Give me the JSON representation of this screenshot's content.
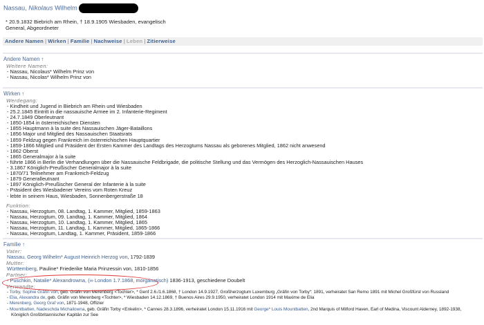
{
  "header": {
    "surname": "Nassau,",
    "given": "Nikolaus",
    "second": "Wilhelm",
    "life_line": "* 20.9.1832 Biebrich am Rhein, † 18.9.1905 Wiesbaden, evangelisch",
    "occupation": "General, Abgeordneter"
  },
  "nav": [
    "Andere Namen",
    "Wirken",
    "Familie",
    "Nachweise",
    "Leben",
    "Zitierweise"
  ],
  "andere_namen": {
    "title": "Andere Namen ↑",
    "sub": "Weitere Namen:",
    "items": [
      "Nassau, Nicolaus* Wilhelm Prinz von",
      "Nassau, Nicolas* Wilhelm Prinz von"
    ]
  },
  "wirken": {
    "title": "Wirken ↑",
    "sub": "Werdegang:",
    "items": [
      "Kindheit und Jugend in Biebrich am Rhein und Wiesbaden",
      "25.2.1845 Eintritt in die nassauische Armee im 2. Infanterie-Regiment",
      "24.7.1849 Oberleutnant",
      "1850-1854 in österreichischen Diensten",
      "1855 Hauptmann à la suite des Nassauischen Jäger-Bataillons",
      "1856 Major und Mitglied des Nassauischen Staatsrats",
      "1859 Feldzug gegen Frankreich im österreichischen Hauptquartier",
      "1859-1866 Mitglied und Präsident der Ersten Kammer des Landtags des Herzogtums Nassau als geborenes Mitglied, 1862 nicht anwesend",
      "1862 Oberst",
      "1865 Generalmajor à la suite",
      "führte 1866 in Berlin die Verhandlungen über die Nassauische Feldbrigade, die politische Stellung und das Vermögen des Herzoglich-Nassauischen Hauses",
      "3.1867 Königlich-Preußischer Generalmajor à la suite",
      "1870/71 Teilnehmer am Frankreich-Feldzug",
      "1879 Generalleutnant",
      "1897 Königlich-Preußischer General der Infanterie à la suite",
      "Präsident des Wiesbadener Vereins vom Roten Kreuz",
      "lebte in seinem Haus, Wiesbaden, Sonnenbergerstraße 18"
    ],
    "funktion_sub": "Funktion:",
    "funktion": [
      "Nassau, Herzogtum, 08. Landtag, 1. Kammer, Mitglied, 1859-1863",
      "Nassau, Herzogtum, 09. Landtag, 1. Kammer, Mitglied, 1864",
      "Nassau, Herzogtum, 10. Landtag, 1. Kammer, Mitglied, 1865",
      "Nassau, Herzogtum, 11. Landtag, 1. Kammer, Mitglied, 1865-1866",
      "Nassau, Herzogtum, Landtag, 1. Kammer, Präsident, 1859-1866"
    ]
  },
  "familie": {
    "title": "Familie ↑",
    "vater_sub": "Vater:",
    "vater_link": "Nassau, Georg Wilhelm* August Heinrich Herzog von",
    "vater_rest": ", 1792-1839",
    "mutter_sub": "Mutter:",
    "mutter_link": "Württemberg",
    "mutter_rest": ", Pauline* Friederike Maria Prinzessin von, 1810-1856",
    "partner_sub": "Partner:",
    "partner_link": "Puschkin, Natalie* Alexandrowna, (∞ London 1.7.1868, morganatisch)",
    "partner_rest": " 1836-1913, geschiedene Doubelt",
    "verwandte_sub": "Verwandte:",
    "v1_link": "Torby, Sophie Gräfin von",
    "v1_rest": ", geb. Gräfin von Merenberg <Tochter>, * Genf 2.6./1.6.1868, † London 14.9.1927, Großherzogtum Luxemburg „Gräfin von Torby“: 1891, verheiratet San Remo 1891 mit Michel Großfürst von Russland",
    "v2_link": "Elia, Alexandra de",
    "v2_rest": ", geb. Gräfin von Merenberg <Tochter>, * Wiesbaden 14.12.1869, † Buenos Aires 29.9.1950, verheiratet London 1914 mit Maxime de Elia",
    "v3_link": "Merenberg, Georg Graf von",
    "v3_rest": ", 1871-1948, Offizier",
    "v4_link": "Mountbatten, Nadeschda Michailowna",
    "v4_rest": ", geb. Gräfin Torby <Enkelin>, * Cannes 28.3.1896, verheiratet London 15.11.1916 mit ",
    "v4_link2": "George* Louis Mountbatten",
    "v4_rest2": ", 2nd Marquis of Milford Haven, Earl of Medina, Viscount Alderney, 1892-1938,",
    "v4_cont": "Königlich Großbritannischer Kapitän zur See"
  },
  "colors": {
    "link": "#3d5f8f",
    "annotation": "#dd3333"
  }
}
